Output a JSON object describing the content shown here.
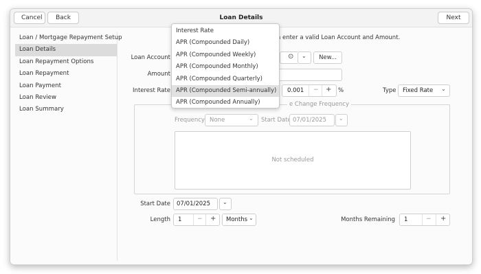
{
  "header": {
    "cancel_label": "Cancel",
    "back_label": "Back",
    "title": "Loan Details",
    "next_label": "Next"
  },
  "sidebar": {
    "items": [
      {
        "label": "Loan / Mortgage Repayment Setup"
      },
      {
        "label": "Loan Details"
      },
      {
        "label": "Loan Repayment Options"
      },
      {
        "label": "Loan Repayment"
      },
      {
        "label": "Loan Payment"
      },
      {
        "label": "Loan Review"
      },
      {
        "label": "Loan Summary"
      }
    ],
    "active_index": 1
  },
  "main": {
    "instruction_visible": "m enter a valid Loan Account and Amount.",
    "loan_account_label": "Loan Account",
    "new_button_label": "New...",
    "amount_label": "Amount",
    "interest_rate_label": "Interest Rate",
    "interest_rate_value": "0.001",
    "percent_sign": "%",
    "type_label": "Type",
    "type_value": "Fixed Rate",
    "rate_change_frequency_legend_visible": "e Change Frequency",
    "frequency_label": "Frequency",
    "frequency_value": "None",
    "freq_start_date_label": "Start Date",
    "freq_start_date_value": "07/01/2025",
    "schedule_empty_text": "Not scheduled",
    "start_date_label": "Start Date",
    "start_date_value": "07/01/2025",
    "length_label": "Length",
    "length_value": "1",
    "length_unit": "Months",
    "months_remaining_label": "Months Remaining",
    "months_remaining_value": "1"
  },
  "dropdown": {
    "options": [
      "Interest Rate",
      "APR (Compounded Daily)",
      "APR (Compounded Weekly)",
      "APR (Compounded Monthly)",
      "APR (Compounded Quarterly)",
      "APR (Compounded Semi-annually)",
      "APR (Compounded Annually)"
    ],
    "highlighted_index": 5
  },
  "icons": {
    "minus": "−",
    "plus": "+",
    "chevron": "⌄"
  }
}
